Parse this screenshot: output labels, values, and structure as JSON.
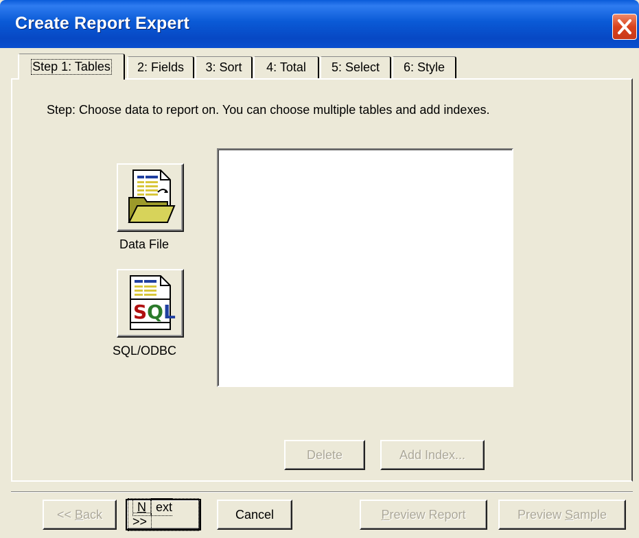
{
  "window": {
    "title": "Create Report Expert",
    "close_icon": "close-x-icon"
  },
  "tabs": [
    {
      "label": "Step 1: Tables",
      "active": true
    },
    {
      "label": "2: Fields",
      "active": false
    },
    {
      "label": "3: Sort",
      "active": false
    },
    {
      "label": "4: Total",
      "active": false
    },
    {
      "label": "5: Select",
      "active": false
    },
    {
      "label": "6: Style",
      "active": false
    }
  ],
  "step": {
    "instructions": "Step: Choose data to report on. You can choose multiple tables and add indexes."
  },
  "sources": {
    "data_file": {
      "label": "Data File",
      "icon": "data-file-folder-icon"
    },
    "sql_odbc": {
      "label": "SQL/ODBC",
      "icon": "sql-database-icon",
      "icon_text": "SQL"
    }
  },
  "table_list": {
    "items": []
  },
  "actions": {
    "delete": {
      "label": "Delete",
      "enabled": false
    },
    "add_index": {
      "label": "Add Index...",
      "enabled": false
    }
  },
  "footer": {
    "back": {
      "pre": "<< ",
      "accel": "B",
      "post": "ack",
      "enabled": false
    },
    "next": {
      "accel": "N",
      "post": "ext >>",
      "enabled": true
    },
    "cancel": {
      "label": "Cancel",
      "enabled": true
    },
    "preview_report": {
      "accel": "P",
      "post": "review Report",
      "enabled": false
    },
    "preview_sample": {
      "pre": "Preview ",
      "accel": "S",
      "post": "ample",
      "enabled": false
    }
  },
  "colors": {
    "titlebar": "#0a5ad6",
    "dialog_bg": "#ece9d8",
    "close_button": "#d9421c",
    "disabled_text": "#aca899"
  }
}
